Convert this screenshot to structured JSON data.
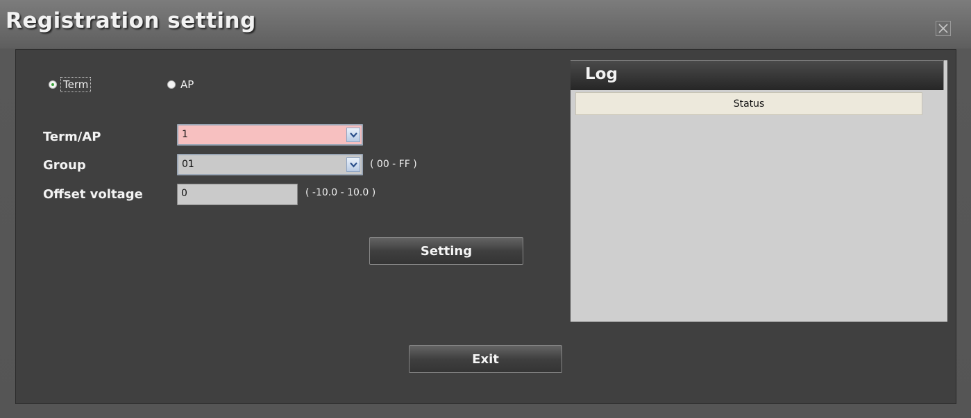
{
  "window": {
    "title": "Registration setting"
  },
  "mode": {
    "options": [
      {
        "label": "Term",
        "checked": true
      },
      {
        "label": "AP",
        "checked": false
      }
    ]
  },
  "form": {
    "term_ap": {
      "label": "Term/AP",
      "value": "1",
      "bg": "#f7c0c0"
    },
    "group": {
      "label": "Group",
      "value": "01",
      "range": "( 00 - FF )",
      "bg": "#c9c9c9"
    },
    "offset": {
      "label": "Offset voltage",
      "value": "0",
      "range": "( -10.0 - 10.0 )"
    }
  },
  "buttons": {
    "setting": "Setting",
    "exit": "Exit"
  },
  "log": {
    "title": "Log",
    "columns": [
      "Status"
    ]
  },
  "icons": {
    "close": "close-icon",
    "dropdown": "chevron-down-icon"
  }
}
